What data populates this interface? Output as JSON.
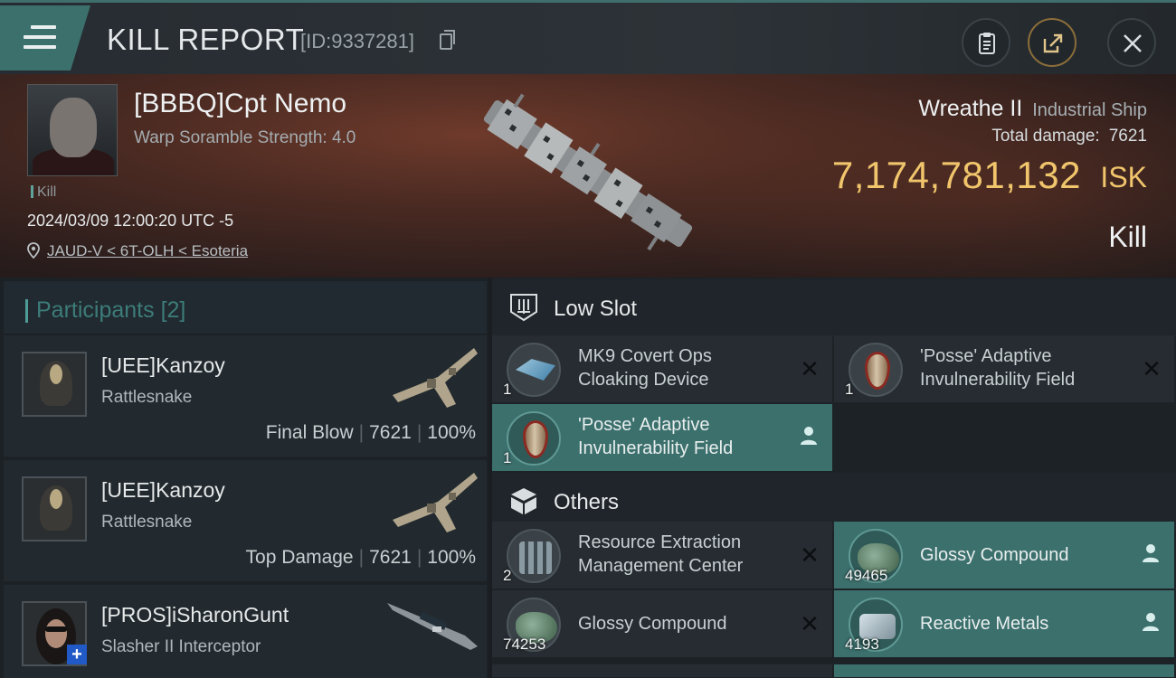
{
  "header": {
    "title": "KILL REPORT",
    "report_id": "[ID:9337281]"
  },
  "victim": {
    "name": "[BBBQ]Cpt Nemo",
    "scramble": "Warp Soramble Strength: 4.0",
    "tag": "Kill",
    "datetime": "2024/03/09 12:00:20 UTC -5",
    "location": "JAUD-V < 6T-OLH < Esoteria"
  },
  "ship": {
    "name": "Wreathe II",
    "class": "Industrial Ship",
    "total_damage_label": "Total damage:",
    "total_damage": "7621",
    "isk_value": "7,174,781,132",
    "isk_unit": "ISK",
    "result": "Kill"
  },
  "participants": {
    "label": "Participants",
    "count": "[2]",
    "rows": [
      {
        "name": "[UEE]Kanzoy",
        "ship": "Rattlesnake",
        "role": "Final Blow",
        "damage": "7621",
        "percent": "100%"
      },
      {
        "name": "[UEE]Kanzoy",
        "ship": "Rattlesnake",
        "role": "Top Damage",
        "damage": "7621",
        "percent": "100%"
      },
      {
        "name": "[PROS]iSharonGunt",
        "ship": "Slasher II Interceptor"
      }
    ]
  },
  "low_slot": {
    "title": "Low Slot",
    "items": [
      {
        "qty": "1",
        "line1": "MK9 Covert Ops",
        "line2": "Cloaking Device",
        "icon": "cloaking-device-icon"
      },
      {
        "qty": "1",
        "line1": "'Posse' Adaptive",
        "line2": "Invulnerability Field",
        "icon": "invulnerability-field-icon"
      },
      {
        "qty": "1",
        "line1": "'Posse' Adaptive",
        "line2": "Invulnerability Field",
        "icon": "invulnerability-field-icon"
      }
    ]
  },
  "others": {
    "title": "Others",
    "items": [
      {
        "qty": "2",
        "line1": "Resource Extraction",
        "line2": "Management Center",
        "icon": "station-icon"
      },
      {
        "qty": "49465",
        "line1": "Glossy Compound",
        "icon": "ore-icon"
      },
      {
        "qty": "74253",
        "line1": "Glossy Compound",
        "icon": "ore-icon"
      },
      {
        "qty": "4193",
        "line1": "Reactive Metals",
        "icon": "metal-icon"
      }
    ]
  },
  "colors": {
    "accent": "#3c706d",
    "isk": "#f0c56c"
  }
}
